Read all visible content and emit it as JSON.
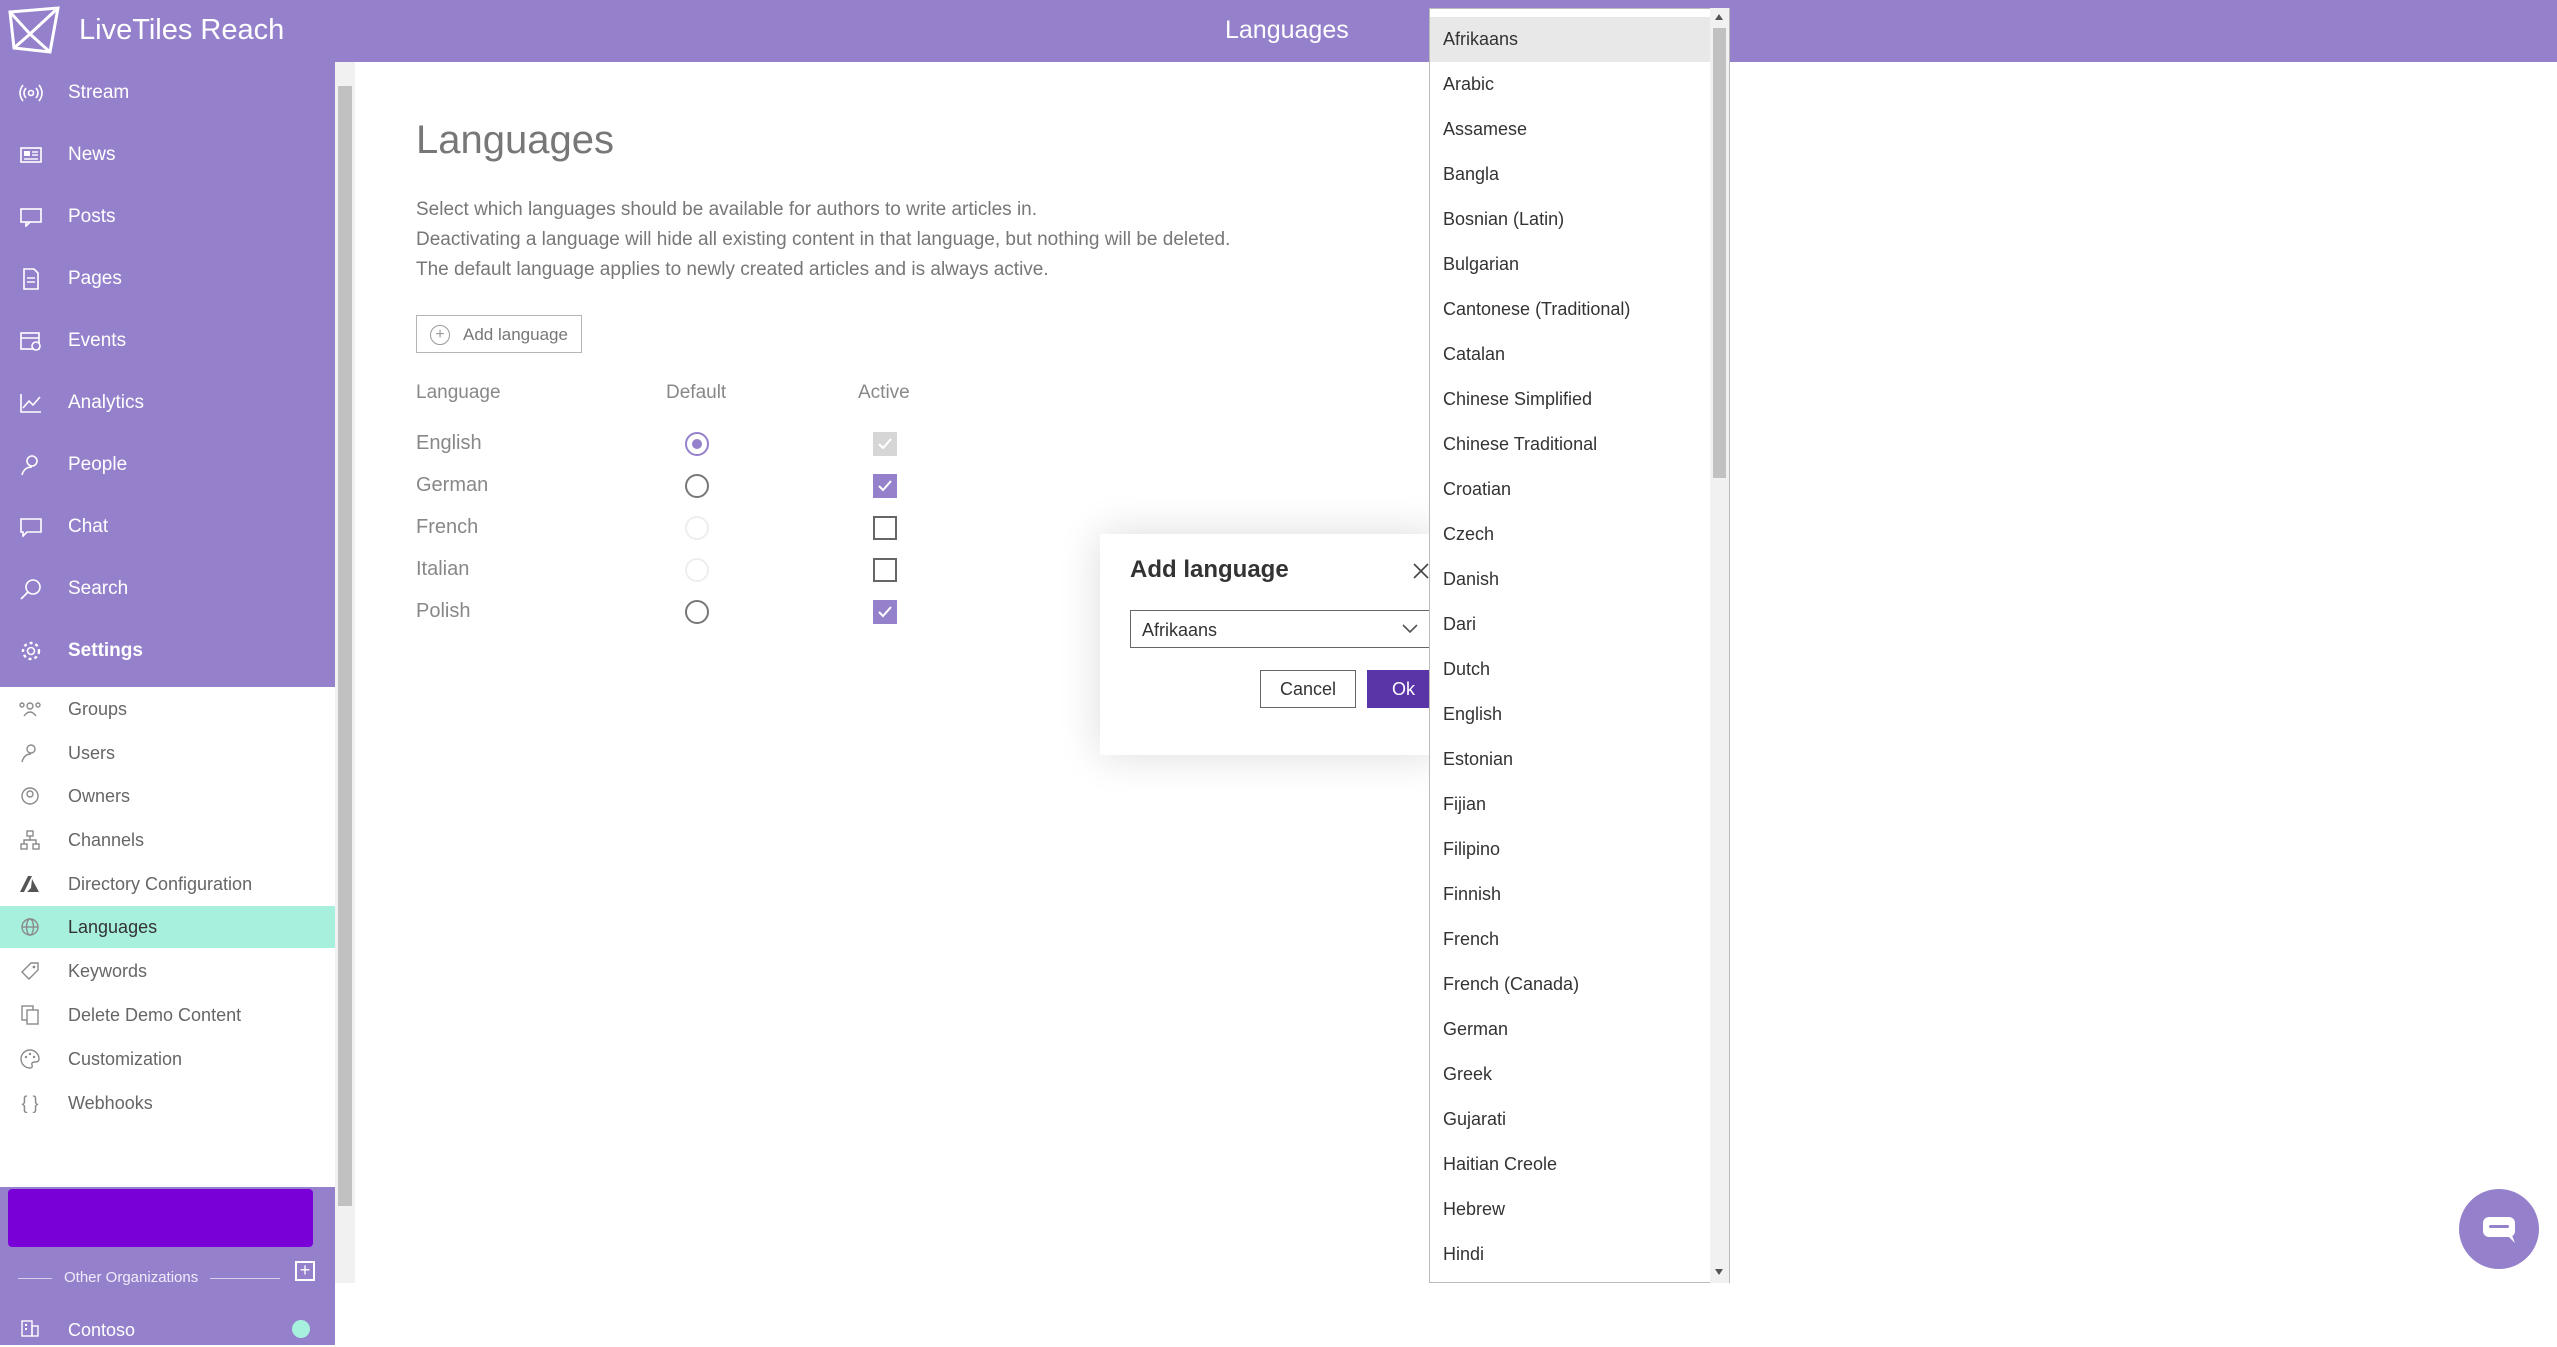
{
  "header": {
    "app_title": "LiveTiles Reach",
    "page_heading": "Languages"
  },
  "sidebar": {
    "nav": [
      {
        "label": "Stream",
        "icon": "broadcast-icon"
      },
      {
        "label": "News",
        "icon": "newspaper-icon"
      },
      {
        "label": "Posts",
        "icon": "posts-icon"
      },
      {
        "label": "Pages",
        "icon": "page-icon"
      },
      {
        "label": "Events",
        "icon": "calendar-icon"
      },
      {
        "label": "Analytics",
        "icon": "chart-icon"
      },
      {
        "label": "People",
        "icon": "people-icon"
      },
      {
        "label": "Chat",
        "icon": "chat-icon"
      },
      {
        "label": "Search",
        "icon": "search-icon"
      },
      {
        "label": "Settings",
        "icon": "gear-icon"
      }
    ],
    "settings_items": [
      {
        "label": "Groups",
        "icon": "groups-icon"
      },
      {
        "label": "Users",
        "icon": "user-icon"
      },
      {
        "label": "Owners",
        "icon": "owner-icon"
      },
      {
        "label": "Channels",
        "icon": "channels-icon"
      },
      {
        "label": "Directory Configuration",
        "icon": "azure-icon"
      },
      {
        "label": "Languages",
        "icon": "globe-icon"
      },
      {
        "label": "Keywords",
        "icon": "tag-icon"
      },
      {
        "label": "Delete Demo Content",
        "icon": "copy-icon"
      },
      {
        "label": "Customization",
        "icon": "palette-icon"
      },
      {
        "label": "Webhooks",
        "icon": "braces-icon"
      }
    ],
    "other_organizations": "Other Organizations",
    "org_name": "Contoso"
  },
  "main": {
    "title": "Languages",
    "description": [
      "Select which languages should be available for authors to write articles in.",
      "Deactivating a language will hide all existing content in that language, but nothing will be deleted.",
      "The default language applies to newly created articles and is always active."
    ],
    "add_language_label": "Add language",
    "columns": [
      "Language",
      "Default",
      "Active"
    ],
    "rows": [
      {
        "name": "English",
        "default": "selected",
        "active": "checked-disabled"
      },
      {
        "name": "German",
        "default": "unselected",
        "active": "checked"
      },
      {
        "name": "French",
        "default": "disabled",
        "active": "unchecked"
      },
      {
        "name": "Italian",
        "default": "disabled",
        "active": "unchecked"
      },
      {
        "name": "Polish",
        "default": "unselected",
        "active": "checked"
      }
    ]
  },
  "dialog": {
    "title": "Add language",
    "selected": "Afrikaans",
    "cancel_label": "Cancel",
    "ok_label": "Ok"
  },
  "dropdown_options": [
    "Afrikaans",
    "Arabic",
    "Assamese",
    "Bangla",
    "Bosnian (Latin)",
    "Bulgarian",
    "Cantonese (Traditional)",
    "Catalan",
    "Chinese Simplified",
    "Chinese Traditional",
    "Croatian",
    "Czech",
    "Danish",
    "Dari",
    "Dutch",
    "English",
    "Estonian",
    "Fijian",
    "Filipino",
    "Finnish",
    "French",
    "French (Canada)",
    "German",
    "Greek",
    "Gujarati",
    "Haitian Creole",
    "Hebrew",
    "Hindi"
  ],
  "colors": {
    "brand": "#9580cc",
    "active_nav": "#a7f0dd",
    "ok_button": "#5a35a8"
  }
}
